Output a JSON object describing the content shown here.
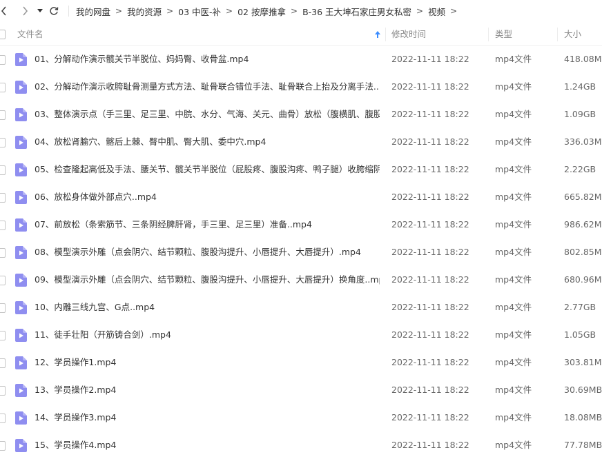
{
  "nav": {
    "breadcrumb": [
      "我的网盘",
      "我的资源",
      "03 中医-补",
      "02 按摩推拿",
      "B-36 王大坤石家庄男女私密",
      "视频"
    ],
    "separator": ">"
  },
  "columns": {
    "name": "文件名",
    "time": "修改时间",
    "type": "类型",
    "size": "大小"
  },
  "colors": {
    "file_icon": "#8f8ef0",
    "sort_arrow": "#3b8cff"
  },
  "files": [
    {
      "name": "01、分解动作演示髋关节半脱位、妈妈臀、收骨盆.mp4",
      "time": "2022-11-11 18:22",
      "type": "mp4文件",
      "size": "418.08MB"
    },
    {
      "name": "02、分解动作演示收胯耻骨测量方式方法、耻骨联合错位手法、耻骨联合上抬及分离手法..m...",
      "time": "2022-11-11 18:22",
      "type": "mp4文件",
      "size": "1.24GB"
    },
    {
      "name": "03、整体演示点（手三里、足三里、中脘、水分、气海、关元、曲骨）放松（腹横肌、腹股...",
      "time": "2022-11-11 18:22",
      "type": "mp4文件",
      "size": "1.09GB"
    },
    {
      "name": "04、放松肾腧穴、髂后上棘、臀中肌、臀大肌、委中穴.mp4",
      "time": "2022-11-11 18:22",
      "type": "mp4文件",
      "size": "336.03MB"
    },
    {
      "name": "05、检查隆起高低及手法、腰关节、髋关节半脱位（屁股疼、腹股沟疼、鸭子腿）收胯缩阴...",
      "time": "2022-11-11 18:22",
      "type": "mp4文件",
      "size": "2.22GB"
    },
    {
      "name": "06、放松身体做外部点穴..mp4",
      "time": "2022-11-11 18:22",
      "type": "mp4文件",
      "size": "665.82MB"
    },
    {
      "name": "07、前放松（条索筋节、三条阴经脾肝肾，手三里、足三里）准备..mp4",
      "time": "2022-11-11 18:22",
      "type": "mp4文件",
      "size": "986.62MB"
    },
    {
      "name": "08、模型演示外雕（点会阴穴、结节颗粒、腹股沟提升、小唇提升、大唇提升）.mp4",
      "time": "2022-11-11 18:22",
      "type": "mp4文件",
      "size": "802.85MB"
    },
    {
      "name": "09、模型演示外雕（点会阴穴、结节颗粒、腹股沟提升、小唇提升、大唇提升）换角度..mp4",
      "time": "2022-11-11 18:22",
      "type": "mp4文件",
      "size": "680.96MB"
    },
    {
      "name": "10、内雕三线九宫、G点..mp4",
      "time": "2022-11-11 18:22",
      "type": "mp4文件",
      "size": "2.77GB"
    },
    {
      "name": "11、徒手壮阳（开筋铸合剑）.mp4",
      "time": "2022-11-11 18:22",
      "type": "mp4文件",
      "size": "1.05GB"
    },
    {
      "name": "12、学员操作1.mp4",
      "time": "2022-11-11 18:22",
      "type": "mp4文件",
      "size": "303.81MB"
    },
    {
      "name": "13、学员操作2.mp4",
      "time": "2022-11-11 18:22",
      "type": "mp4文件",
      "size": "30.69MB"
    },
    {
      "name": "14、学员操作3.mp4",
      "time": "2022-11-11 18:22",
      "type": "mp4文件",
      "size": "18.08MB"
    },
    {
      "name": "15、学员操作4.mp4",
      "time": "2022-11-11 18:22",
      "type": "mp4文件",
      "size": "77.78MB"
    }
  ]
}
